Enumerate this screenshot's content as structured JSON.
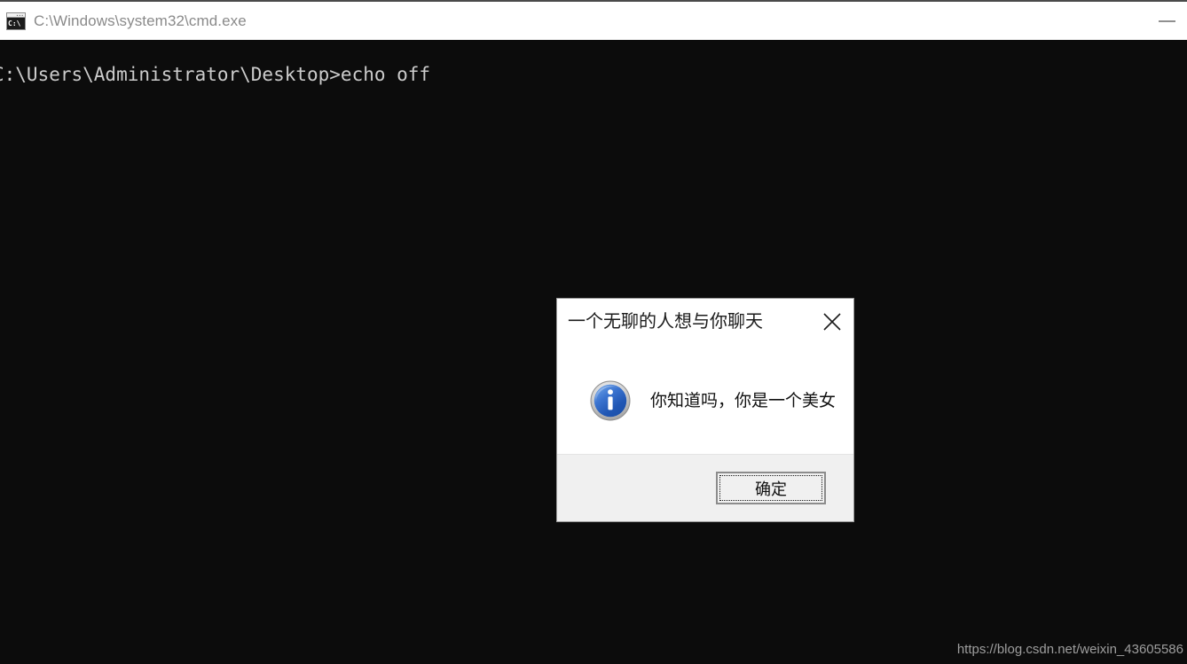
{
  "window": {
    "title": "C:\\Windows\\system32\\cmd.exe",
    "icon_name": "cmd-console-icon",
    "icon_glyph": "C:\\",
    "background_color": "#0c0c0c",
    "titlebar_color": "#ffffff",
    "title_text_color": "#8a8a8a",
    "controls": {
      "minimize_label": "—",
      "minimize_name": "minimize-button"
    }
  },
  "console": {
    "lines": [
      "C:\\Users\\Administrator\\Desktop>echo off"
    ],
    "text_color": "#cccccc"
  },
  "watermark": {
    "text": "https://blog.csdn.net/weixin_43605586",
    "color": "#9e9e9e"
  },
  "dialog": {
    "title": "一个无聊的人想与你聊天",
    "message": "你知道吗，你是一个美女",
    "icon_name": "info-icon",
    "icon_color": "#2a62c4",
    "close_label": "×",
    "buttons": [
      {
        "label": "确定",
        "name": "ok-button",
        "focused": true
      }
    ],
    "body_background": "#ffffff",
    "footer_background": "#f0f0f0",
    "border_color": "#9b9b9b"
  }
}
